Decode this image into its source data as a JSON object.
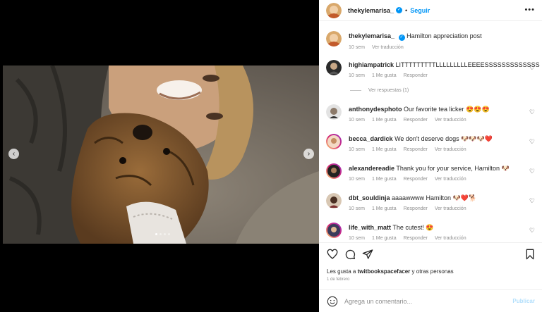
{
  "post": {
    "username": "thekylemarisa_",
    "follow_label": "Seguir",
    "separator": "•",
    "caption_text": "Hamilton appreciation post",
    "caption_time": "10 sem",
    "see_translation": "Ver traducción"
  },
  "comments": [
    {
      "user": "highiampatrick",
      "text": "LITTTTTTTTTLLLLLLLLLEEEESSSSSSSSSSSSS",
      "time": "10 sem",
      "likes": "1 Me gusta",
      "reply": "Responder",
      "translate": ""
    },
    {
      "user": "anthonydesphoto",
      "text": "Our favorite tea licker 😍😍😍",
      "time": "10 sem",
      "likes": "1 Me gusta",
      "reply": "Responder",
      "translate": "Ver traducción"
    },
    {
      "user": "becca_dardick",
      "text": "We don't deserve dogs 🐶🐶🐶❤️",
      "time": "10 sem",
      "likes": "1 Me gusta",
      "reply": "Responder",
      "translate": "Ver traducción"
    },
    {
      "user": "alexandereadie",
      "text": "Thank you for your service, Hamilton 🐶",
      "time": "10 sem",
      "likes": "1 Me gusta",
      "reply": "Responder",
      "translate": "Ver traducción"
    },
    {
      "user": "dbt_souldinja",
      "text": "aaaawwww Hamilton 🐶❤️🐕",
      "time": "10 sem",
      "likes": "1 Me gusta",
      "reply": "Responder",
      "translate": "Ver traducción"
    },
    {
      "user": "life_with_matt",
      "text": "The cutest! 😍",
      "time": "10 sem",
      "likes": "1 Me gusta",
      "reply": "Responder",
      "translate": "Ver traducción"
    }
  ],
  "view_replies": "Ver respuestas (1)",
  "likes_prefix": "Les gusta a ",
  "likes_user": "twitbookspacefacer",
  "likes_suffix": " y otras personas",
  "post_date": "1 de febrero",
  "add_comment_placeholder": "Agrega un comentario...",
  "publish_label": "Publicar",
  "icons": [
    "heart-icon",
    "comment-icon",
    "share-icon",
    "bookmark-icon",
    "emoji-icon",
    "more-icon",
    "chevron-left-icon",
    "chevron-right-icon",
    "verified-icon"
  ],
  "colors": {
    "accent": "#0095f6",
    "publish_disabled": "#b2dffc",
    "meta": "#8e8e8e"
  }
}
